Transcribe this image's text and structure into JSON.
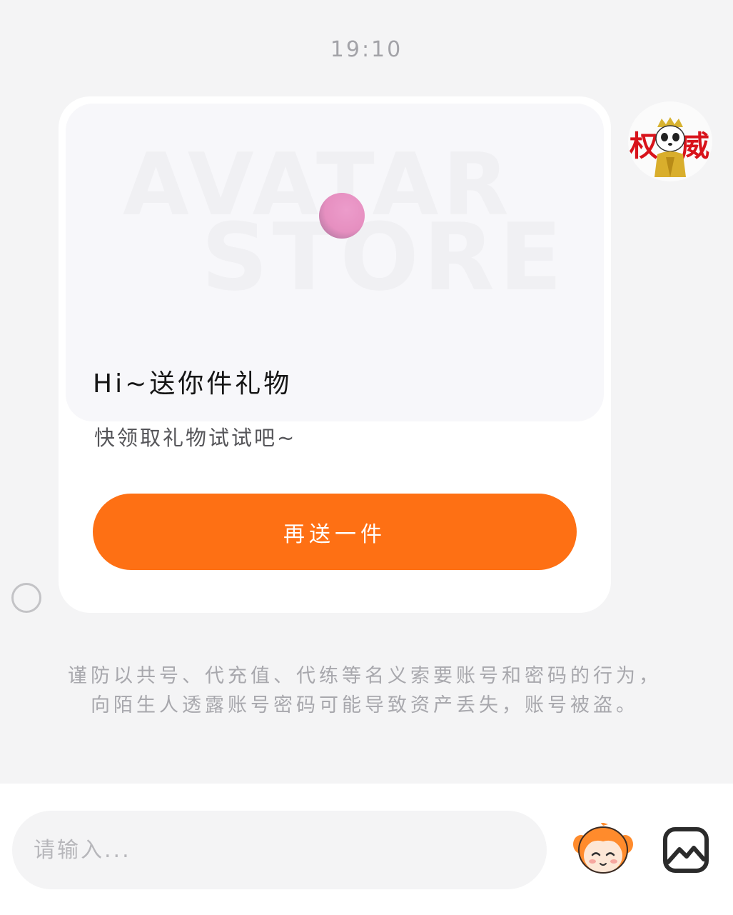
{
  "chat": {
    "timestamp": "19:10",
    "card": {
      "banner_watermark_top": "AVATAR",
      "banner_watermark_bottom": "STORE",
      "title": "Hi~送你件礼物",
      "subtitle": "快领取礼物试试吧~",
      "button_label": "再送一件"
    },
    "avatar_text_left": "权",
    "avatar_text_right": "威"
  },
  "notice": "谨防以共号、代充值、代练等名义索要账号和密码的行为，向陌生人透露账号密码可能导致资产丢失，账号被盗。",
  "input_bar": {
    "placeholder": "请输入...",
    "value": ""
  },
  "colors": {
    "accent": "#fe7014",
    "background": "#f4f4f5",
    "card": "#ffffff"
  },
  "icons": {
    "loading": "loading-spinner-icon",
    "status": "status-circle-icon",
    "mascot": "mascot-emoji-icon",
    "image": "image-icon"
  }
}
